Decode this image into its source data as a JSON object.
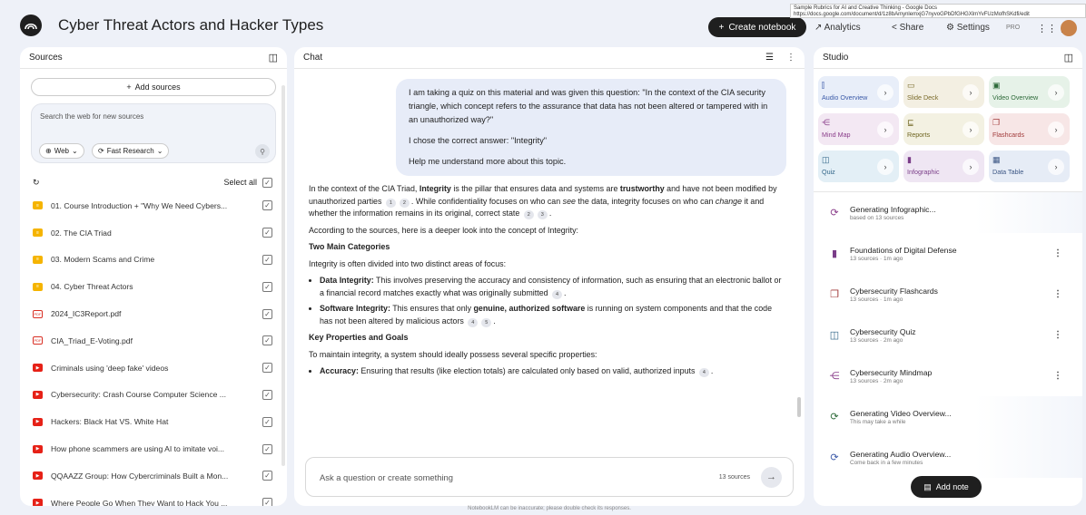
{
  "tooltip": {
    "title": "Sample Rubrics for AI and Creative Thinking - Google Docs",
    "url": "https://docs.google.com/document/d/1z8bAmynlemxjG7nyvoGPbDfGHGXlmYvFUzMofhSKdfi/edit"
  },
  "header": {
    "title": "Cyber Threat Actors and Hacker Types",
    "create_label": "Create notebook",
    "analytics_label": "Analytics",
    "share_label": "Share",
    "settings_label": "Settings",
    "plan_label": "PRO"
  },
  "sources": {
    "title": "Sources",
    "add_label": "Add sources",
    "search_placeholder": "Search the web for new sources",
    "web_chip": "Web",
    "research_chip": "Fast Research",
    "select_all": "Select all",
    "items": [
      {
        "label": "01. Course Introduction + \"Why We Need Cybers...",
        "type": "doc"
      },
      {
        "label": "02. The CIA Triad",
        "type": "doc"
      },
      {
        "label": "03. Modern Scams and Crime",
        "type": "doc"
      },
      {
        "label": "04. Cyber Threat Actors",
        "type": "doc"
      },
      {
        "label": "2024_IC3Report.pdf",
        "type": "pdf"
      },
      {
        "label": "CIA_Triad_E-Voting.pdf",
        "type": "pdf"
      },
      {
        "label": "Criminals using 'deep fake' videos",
        "type": "yt"
      },
      {
        "label": "Cybersecurity: Crash Course Computer Science ...",
        "type": "yt"
      },
      {
        "label": "Hackers: Black Hat VS. White Hat",
        "type": "yt"
      },
      {
        "label": "How phone scammers are using AI to imitate voi...",
        "type": "yt"
      },
      {
        "label": "QQAAZZ Group: How Cybercriminals Built a Mon...",
        "type": "yt"
      },
      {
        "label": "Where People Go When They Want to Hack You ...",
        "type": "yt"
      }
    ]
  },
  "chat": {
    "title": "Chat",
    "user_msg": {
      "p1": "I am taking a quiz on this material and was given this question: \"In the context of the CIA security triangle, which concept refers to the assurance that data has not been altered or tampered with in an unauthorized way?\"",
      "p2": "I chose the correct answer: \"Integrity\"",
      "p3": "Help me understand more about this topic."
    },
    "answer": {
      "a1": "In the context of the CIA Triad, ",
      "a1b": "Integrity",
      "a2": " is the pillar that ensures data and systems are ",
      "a2b": "trustworthy",
      "a3": " and have not been modified by unauthorized parties",
      "a4": ". While confidentiality focuses on who can ",
      "a4i": "see",
      "a5": " the data, integrity focuses on who can ",
      "a5i": "change",
      "a6": " it and whether the information remains in its original, correct state",
      "c1": "1",
      "c2": "2",
      "c3": "3",
      "c4": "4",
      "c5": "5",
      "p2": "According to the sources, here is a deeper look into the concept of Integrity:",
      "h1": "Two Main Categories",
      "p3": "Integrity is often divided into two distinct areas of focus:",
      "b1b": "Data Integrity:",
      "b1": " This involves preserving the accuracy and consistency of information, such as ensuring that an electronic ballot or a financial record matches exactly what was originally submitted",
      "b2b": "Software Integrity:",
      "b2": " This ensures that only ",
      "b2bb": "genuine, authorized software",
      "b2c": " is running on system components and that the code has not been altered by malicious actors",
      "h2": "Key Properties and Goals",
      "p4": "To maintain integrity, a system should ideally possess several specific properties:",
      "b3b": "Accuracy:",
      "b3": " Ensuring that results (like election totals) are calculated only based on valid, authorized inputs"
    },
    "input_placeholder": "Ask a question or create something",
    "sources_count": "13 sources"
  },
  "footer": "NotebookLM can be inaccurate; please double check its responses.",
  "studio": {
    "title": "Studio",
    "tiles": [
      {
        "label": "Audio Overview",
        "icon": "audio-wave-icon",
        "glyph": "⫿",
        "bg": "#e8eef9",
        "fg": "#3b5aa8"
      },
      {
        "label": "Slide Deck",
        "icon": "slide-deck-icon",
        "glyph": "▭",
        "bg": "#f3efe2",
        "fg": "#7a6a2a"
      },
      {
        "label": "Video Overview",
        "icon": "video-icon",
        "glyph": "▣",
        "bg": "#e6f2e8",
        "fg": "#2e6b3a"
      },
      {
        "label": "Mind Map",
        "icon": "mind-map-icon",
        "glyph": "⋲",
        "bg": "#f3e8f3",
        "fg": "#8a3d8a"
      },
      {
        "label": "Reports",
        "icon": "reports-icon",
        "glyph": "⊑",
        "bg": "#f3f1e2",
        "fg": "#6e6420"
      },
      {
        "label": "Flashcards",
        "icon": "flashcards-icon",
        "glyph": "❐",
        "bg": "#f7e6e6",
        "fg": "#a13a3a"
      },
      {
        "label": "Quiz",
        "icon": "quiz-icon",
        "glyph": "◫",
        "bg": "#e3eff6",
        "fg": "#2f6487"
      },
      {
        "label": "Infographic",
        "icon": "infographic-icon",
        "glyph": "▮",
        "bg": "#efe6f3",
        "fg": "#7a3d88"
      },
      {
        "label": "Data Table",
        "icon": "data-table-icon",
        "glyph": "▦",
        "bg": "#e6ecf6",
        "fg": "#3b5684"
      }
    ],
    "items": [
      {
        "title": "Generating Infographic...",
        "sub": "based on 13 sources",
        "icon": "sync-icon",
        "glyph": "⟳",
        "color": "#8a3d8a",
        "more": false
      },
      {
        "title": "Foundations of Digital Defense",
        "sub": "13 sources · 1m ago",
        "icon": "infographic-icon",
        "glyph": "▮",
        "color": "#7a3d88",
        "more": true
      },
      {
        "title": "Cybersecurity Flashcards",
        "sub": "13 sources · 1m ago",
        "icon": "flashcards-icon",
        "glyph": "❐",
        "color": "#a13a3a",
        "more": true
      },
      {
        "title": "Cybersecurity Quiz",
        "sub": "13 sources · 2m ago",
        "icon": "quiz-icon",
        "glyph": "◫",
        "color": "#2f6487",
        "more": true
      },
      {
        "title": "Cybersecurity Mindmap",
        "sub": "13 sources · 2m ago",
        "icon": "mind-map-icon",
        "glyph": "⋲",
        "color": "#8a3d8a",
        "more": true
      },
      {
        "title": "Generating Video Overview...",
        "sub": "This may take a while",
        "icon": "sync-icon",
        "glyph": "⟳",
        "color": "#2e6b3a",
        "more": false
      },
      {
        "title": "Generating Audio Overview...",
        "sub": "Come back in a few minutes",
        "icon": "sync-icon",
        "glyph": "⟳",
        "color": "#3b5aa8",
        "more": false
      }
    ],
    "add_note_label": "Add note"
  }
}
